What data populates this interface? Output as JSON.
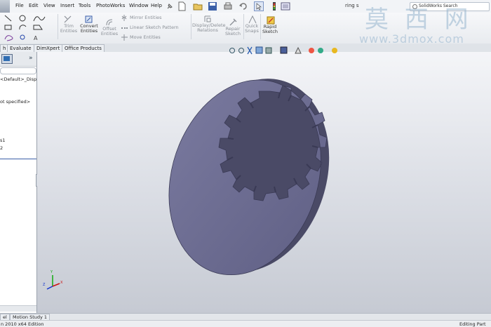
{
  "app": {
    "menus": [
      "File",
      "Edit",
      "View",
      "Insert",
      "Tools",
      "PhotoWorks",
      "Window",
      "Help"
    ],
    "document_name": "ring s",
    "search_placeholder": "SolidWorks Search"
  },
  "ribbon": {
    "trim_entities": [
      "Trim",
      "Entities"
    ],
    "convert_entities": [
      "Convert",
      "Entities"
    ],
    "offset_entities": [
      "Offset",
      "Entities"
    ],
    "mirror_entities": "Mirror Entities",
    "linear_sketch_pattern": "Linear Sketch Pattern",
    "move_entities": "Move Entities",
    "display_delete_relations": [
      "Display/Delete",
      "Relations"
    ],
    "repair_sketch": [
      "Repair",
      "Sketch"
    ],
    "quick_snaps": [
      "Quick",
      "Snaps"
    ],
    "rapid_sketch": [
      "Rapid",
      "Sketch"
    ]
  },
  "tabs": [
    "h",
    "Evaluate",
    "DimXpert",
    "Office Products"
  ],
  "left_panel": {
    "lines": [
      "<Default>_Disp",
      "ot specified>",
      "s1",
      "2"
    ]
  },
  "bottom_tabs": [
    "el",
    "Motion Study 1"
  ],
  "status": {
    "left": "n 2010 x64 Edition",
    "right": "Editing Part"
  },
  "watermark": {
    "chinese": "莫 西 网",
    "url": "www.3dmox.com"
  },
  "triad": {
    "x": "X",
    "y": "Y",
    "z": "Z"
  },
  "colors": {
    "part_face": "#6e6e90",
    "part_side": "#4e4e6c",
    "viewport_top": "#f4f5f8",
    "viewport_bottom": "#c6cad3",
    "triad_x": "#cc1111",
    "triad_y": "#11aa11",
    "triad_z": "#1133cc"
  }
}
